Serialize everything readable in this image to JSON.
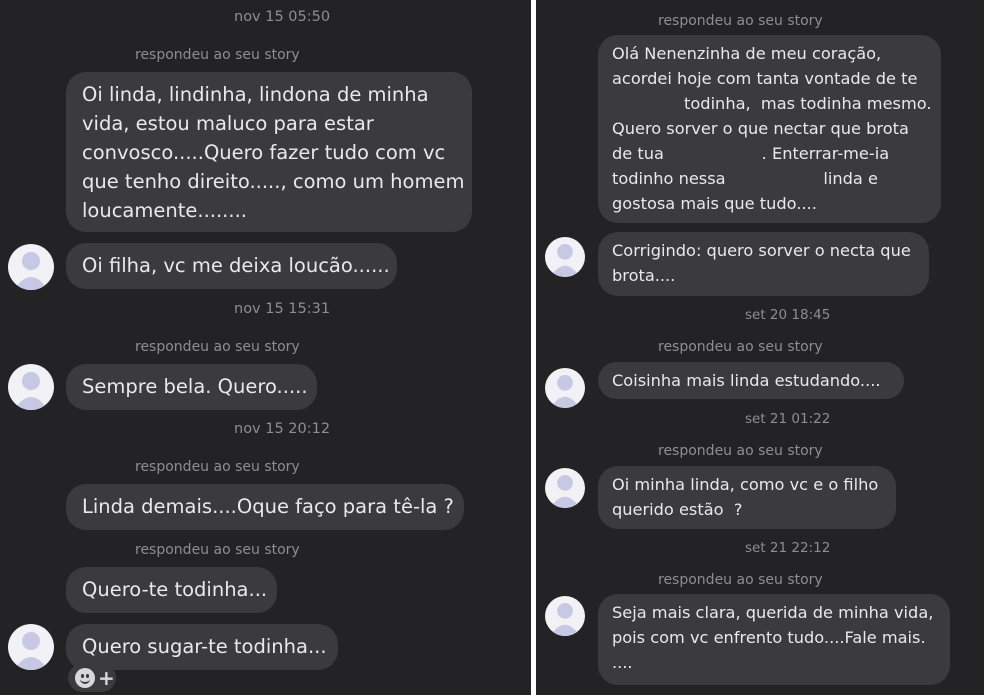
{
  "left": {
    "ts1": "nov 15 05:50",
    "reply1": "respondeu ao seu story",
    "msg1": [
      "Oi linda, lindinha, lindona de minha",
      "vida, estou maluco para estar",
      "convosco.....Quero fazer tudo com vc",
      "que tenho direito....., como um homem",
      "loucamente........"
    ],
    "msg2": "Oi filha, vc me deixa loucão......",
    "ts2": "nov 15 15:31",
    "reply2": "respondeu ao seu story",
    "msg3": "Sempre bela. Quero.....",
    "ts3": "nov 15 20:12",
    "reply3": "respondeu ao seu story",
    "msg4": "Linda demais....Oque faço para tê-la ?",
    "reply4": "respondeu ao seu story",
    "msg5": "Quero-te todinha...",
    "msg6": "Quero sugar-te todinha...",
    "reaction": {
      "emoji_icon": "smiley-icon",
      "plus": "+"
    }
  },
  "right": {
    "reply1": "respondeu ao seu story",
    "msg1": [
      "Olá Nenenzinha de meu coração,",
      "acordei hoje com tanta vontade de te",
      "              todinha,  mas todinha mesmo.",
      "Quero sorver o que nectar que brota",
      "de tua                   . Enterrar-me-ia",
      "todinho nessa                   linda e",
      "gostosa mais que tudo...."
    ],
    "msg2": [
      "Corrigindo: quero sorver o necta que",
      "brota...."
    ],
    "ts1": "set 20 18:45",
    "reply2": "respondeu ao seu story",
    "msg3": "Coisinha mais linda estudando....",
    "ts2": "set 21 01:22",
    "reply3": "respondeu ao seu story",
    "msg4": [
      "Oi minha linda, como vc e o filho",
      "querido estão  ?"
    ],
    "ts3": "set 21 22:12",
    "reply4": "respondeu ao seu story",
    "msg5": [
      "Seja mais clara, querida de minha vida,",
      "pois com vc enfrento tudo....Fale mais.",
      "...."
    ]
  },
  "colors": {
    "background": "#232326",
    "bubble": "#3b3b3f",
    "text": "#e9e9ec",
    "meta": "#8d8d93",
    "avatar": "#f1f1f6"
  }
}
